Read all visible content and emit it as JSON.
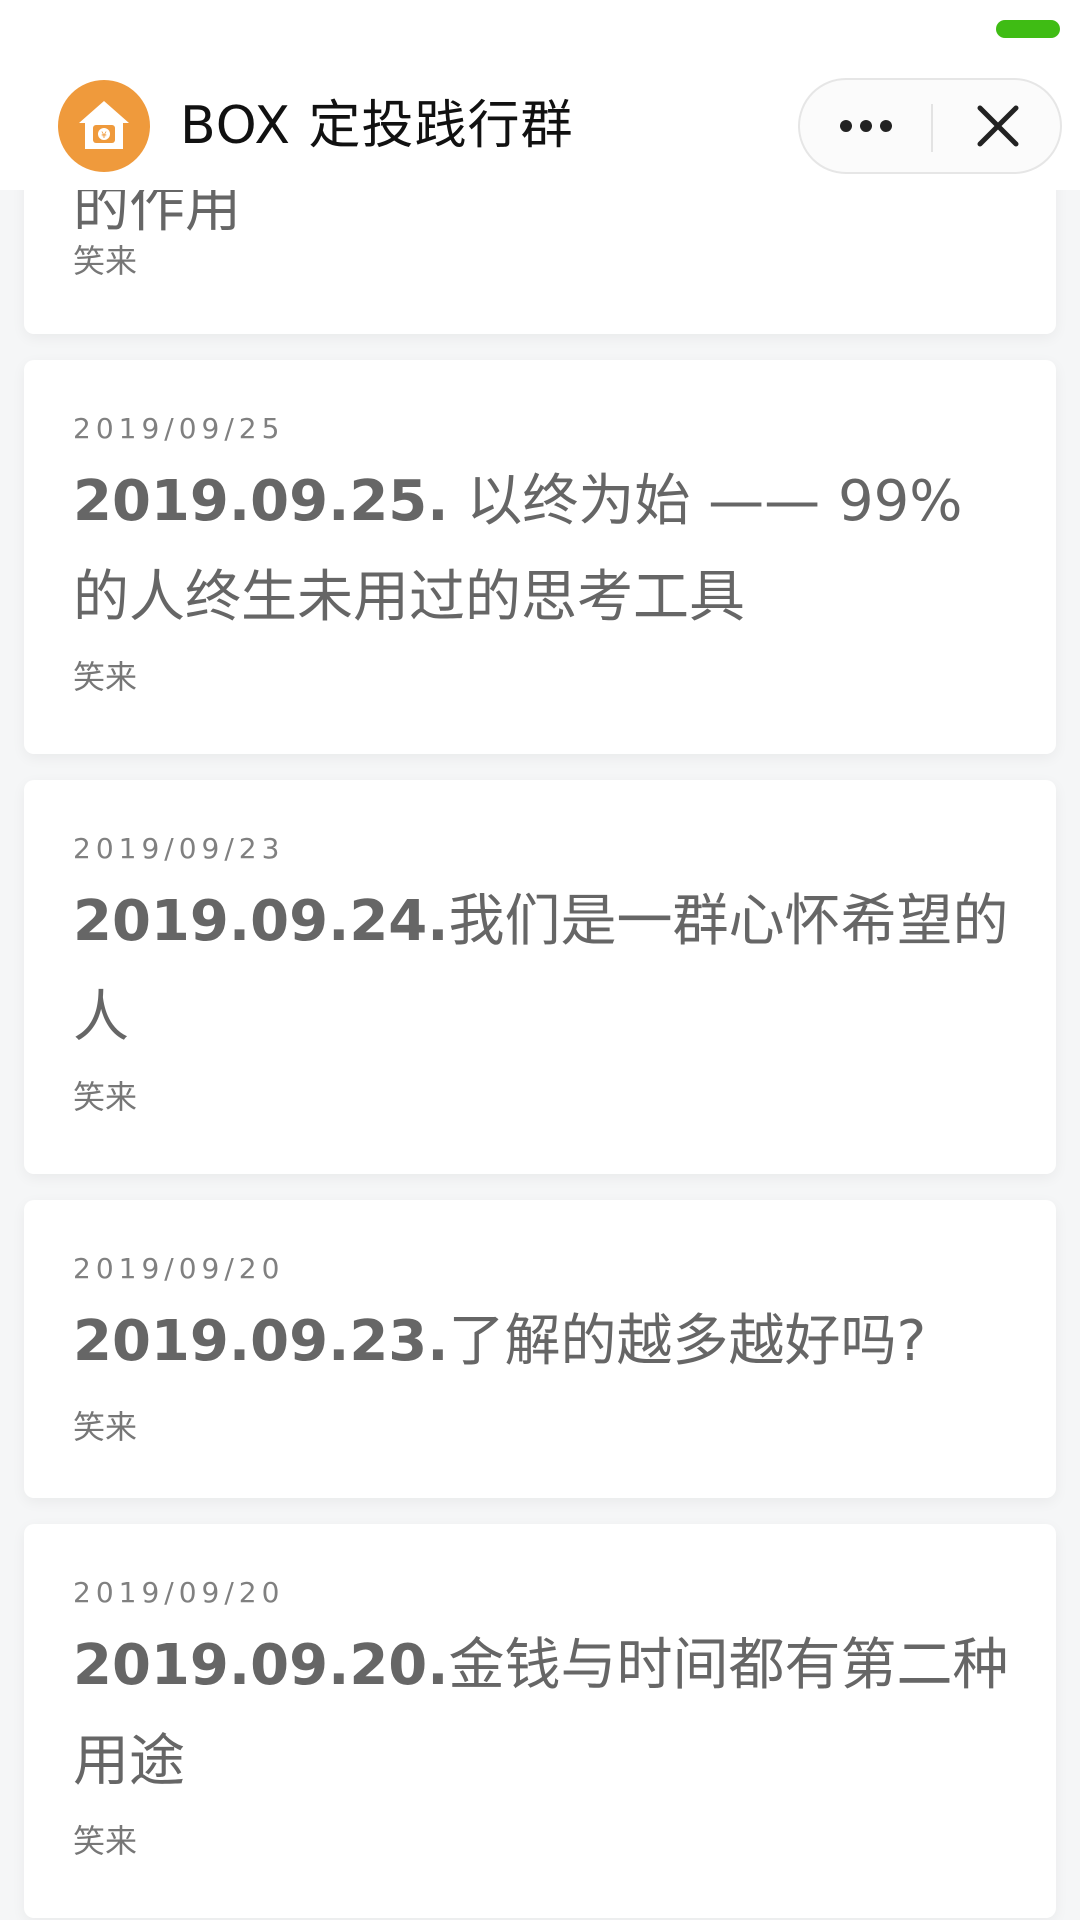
{
  "topbar": {
    "title": "BOX 定投践行群",
    "logo_icon": "piggy-house-icon",
    "more_icon": "more-dots-icon",
    "close_icon": "close-icon",
    "accent": "#3fbc14",
    "logo_color": "#ef9a3c"
  },
  "partial_card": {
    "title_tail": "的作用",
    "author": "笑来"
  },
  "articles": [
    {
      "date": "2019/09/25",
      "title_bold": "2019.09.25.",
      "title_rest": " 以终为始 —— 99% 的人终生未用过的思考工具",
      "author": "笑来"
    },
    {
      "date": "2019/09/23",
      "title_bold": "2019.09.24.",
      "title_rest": "我们是一群心怀希望的人",
      "author": "笑来"
    },
    {
      "date": "2019/09/20",
      "title_bold": "2019.09.23.",
      "title_rest": "了解的越多越好吗?",
      "author": "笑来"
    },
    {
      "date": "2019/09/20",
      "title_bold": "2019.09.20.",
      "title_rest": "金钱与时间都有第二种用途",
      "author": "笑来"
    }
  ]
}
